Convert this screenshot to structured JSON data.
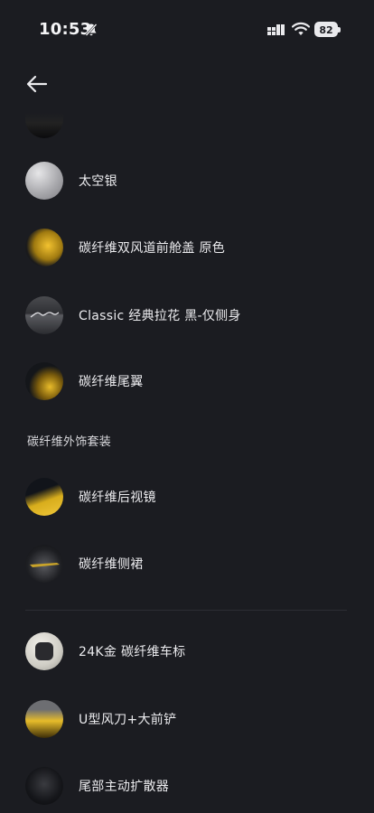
{
  "status_bar": {
    "time": "10:53",
    "battery": "82"
  },
  "items_top": [
    {
      "label": "太空银",
      "icon": "silver-swatch"
    },
    {
      "label": "碳纤维双风道前舱盖 原色",
      "icon": "carbon-hood-thumbnail"
    },
    {
      "label": "Classic 经典拉花 黑-仅侧身",
      "icon": "classic-decal-thumbnail"
    },
    {
      "label": "碳纤维尾翼",
      "icon": "carbon-rear-wing-thumbnail"
    }
  ],
  "section_title": "碳纤维外饰套装",
  "items_section": [
    {
      "label": "碳纤维后视镜",
      "icon": "carbon-mirror-thumbnail"
    },
    {
      "label": "碳纤维侧裙",
      "icon": "carbon-side-skirt-thumbnail"
    }
  ],
  "items_bottom": [
    {
      "label": "24K金 碳纤维车标",
      "icon": "badge-thumbnail"
    },
    {
      "label": "U型风刀+大前铲",
      "icon": "front-splitter-thumbnail"
    },
    {
      "label": "尾部主动扩散器",
      "icon": "rear-diffuser-thumbnail"
    }
  ]
}
